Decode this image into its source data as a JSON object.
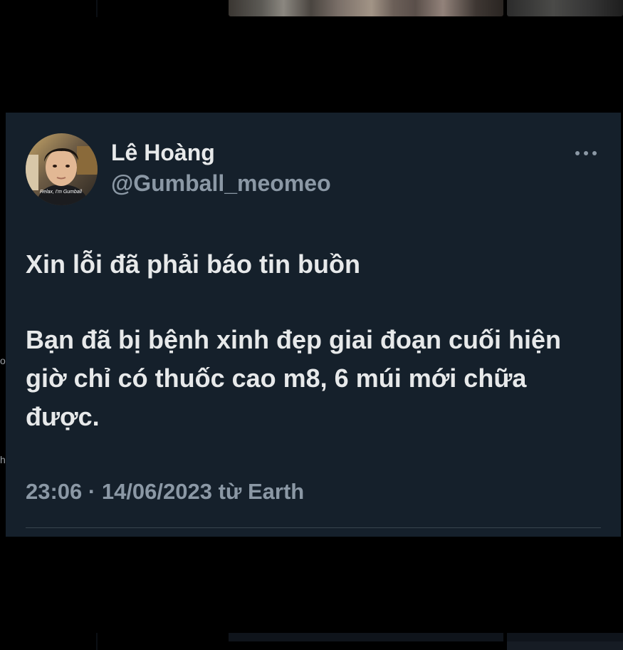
{
  "tweet": {
    "display_name": "Lê Hoàng",
    "handle": "@Gumball_meomeo",
    "avatar_caption": "Relax, I'm Gumball",
    "more_icon": "more-horizontal-icon",
    "text_lines_1": [
      "Xin lỗi đã phải báo tin buồn"
    ],
    "text_lines_2": [
      "Bạn đã bị bệnh xinh đẹp giai đoạn cuối hiện",
      "giờ chỉ có thuốc cao m8, 6 múi mới chữa",
      "được."
    ],
    "timestamp": "23:06 · 14/06/2023 từ Earth"
  },
  "colors": {
    "page_background": "#000000",
    "card_background": "#15202b",
    "primary_text": "#e7e9ea",
    "secondary_text": "#8b98a5",
    "divider": "#38444d"
  },
  "edge_glyphs": [
    "o",
    "h"
  ]
}
